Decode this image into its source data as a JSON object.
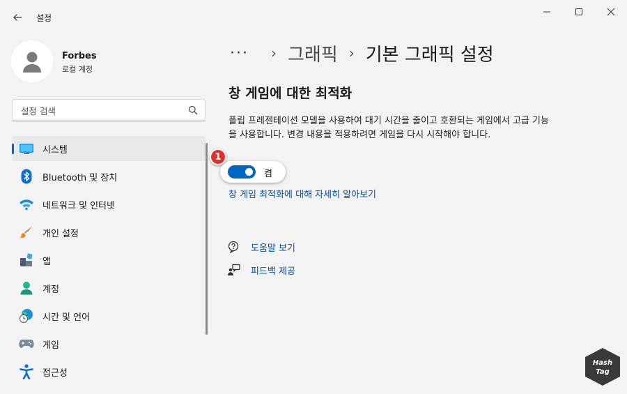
{
  "app": {
    "title": "설정"
  },
  "window_controls": {
    "minimize": "minimize-icon",
    "maximize": "maximize-icon",
    "close": "close-icon"
  },
  "profile": {
    "name": "Forbes",
    "account_type": "로컬 계정"
  },
  "search": {
    "placeholder": "설정 검색"
  },
  "sidebar": {
    "items": [
      {
        "label": "시스템",
        "icon": "system-icon",
        "selected": true
      },
      {
        "label": "Bluetooth 및 장치",
        "icon": "bluetooth-icon"
      },
      {
        "label": "네트워크 및 인터넷",
        "icon": "wifi-icon"
      },
      {
        "label": "개인 설정",
        "icon": "brush-icon"
      },
      {
        "label": "앱",
        "icon": "apps-icon"
      },
      {
        "label": "계정",
        "icon": "account-icon"
      },
      {
        "label": "시간 및 언어",
        "icon": "globe-clock-icon"
      },
      {
        "label": "게임",
        "icon": "gamepad-icon"
      },
      {
        "label": "접근성",
        "icon": "accessibility-icon"
      }
    ]
  },
  "breadcrumb": {
    "more": "···",
    "parent": "그래픽",
    "current": "기본 그래픽 설정"
  },
  "section": {
    "title": "창 게임에 대한 최적화",
    "description": "플립 프레젠테이션 모델을 사용하여 대기 시간을 줄이고 호환되는 게임에서 고급 기능을 사용합니다. 변경 내용을 적용하려면 게임을 다시 시작해야 합니다.",
    "toggle_state": "켬",
    "toggle_on": true,
    "learn_more": "창 게임 최적화에 대해 자세히 알아보기"
  },
  "annotation": {
    "badge": "1"
  },
  "help": {
    "get_help": "도움말 보기",
    "feedback": "피드백 제공"
  },
  "watermark": {
    "line1": "Hash",
    "line2": "Tag"
  },
  "colors": {
    "accent": "#0067c0",
    "badge": "#e0322d",
    "link": "#0050a8"
  }
}
